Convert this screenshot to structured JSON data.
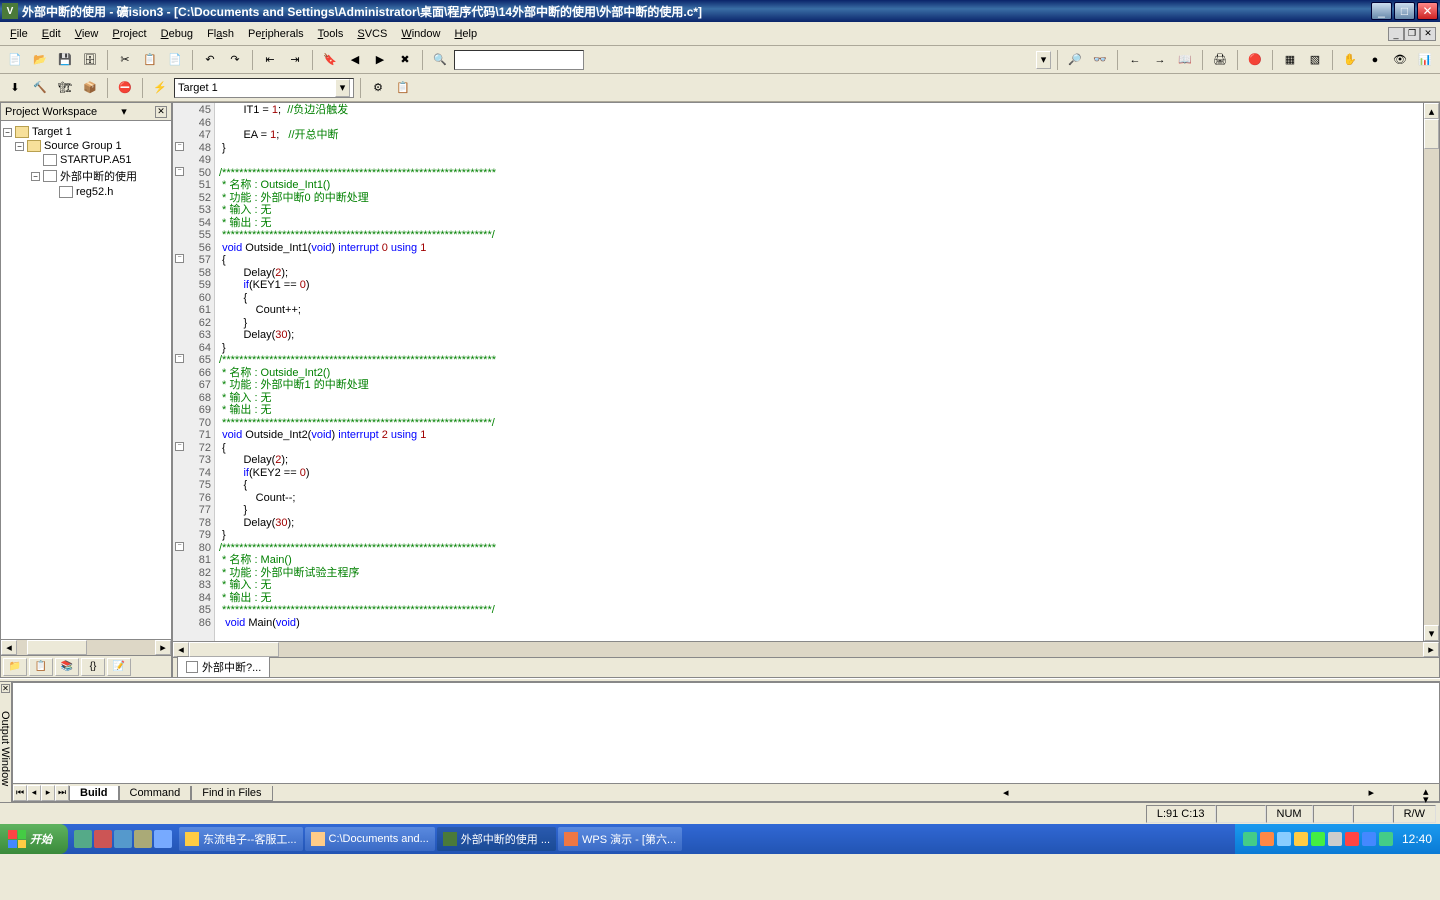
{
  "window": {
    "title": "外部中断的使用  - 礦ision3  - [C:\\Documents and Settings\\Administrator\\桌面\\程序代码\\14外部中断的使用\\外部中断的使用.c*]",
    "app_icon_text": "V"
  },
  "menubar": {
    "file": "File",
    "edit": "Edit",
    "view": "View",
    "project": "Project",
    "debug": "Debug",
    "flash": "Flash",
    "peripherals": "Peripherals",
    "tools": "Tools",
    "svcs": "SVCS",
    "window": "Window",
    "help": "Help"
  },
  "toolbar2": {
    "target_label": "Target 1"
  },
  "workspace": {
    "title": "Project Workspace",
    "root": "Target 1",
    "group": "Source Group 1",
    "file1": "STARTUP.A51",
    "file2": "外部中断的使用",
    "file3": "reg52.h"
  },
  "code": {
    "lines": [
      {
        "n": 45,
        "t": "        IT1 = 1;  ",
        "c": "//负边沿触发"
      },
      {
        "n": 46,
        "t": ""
      },
      {
        "n": 47,
        "t": "        EA = 1;   ",
        "c": "//开总中断"
      },
      {
        "n": 48,
        "t": " }",
        "fold": "open"
      },
      {
        "n": 49,
        "t": ""
      },
      {
        "n": 50,
        "t": "",
        "c": "/****************************************************************",
        "fold": "open"
      },
      {
        "n": 51,
        "t": "",
        "c": " * 名称 : Outside_Int1()"
      },
      {
        "n": 52,
        "t": "",
        "c": " * 功能 : 外部中断0 的中断处理"
      },
      {
        "n": 53,
        "t": "",
        "c": " * 输入 : 无"
      },
      {
        "n": 54,
        "t": "",
        "c": " * 输出 : 无"
      },
      {
        "n": 55,
        "t": "",
        "c": " ***************************************************************/"
      },
      {
        "n": 56,
        "t": " void Outside_Int1(void) interrupt 0 using 1"
      },
      {
        "n": 57,
        "t": " {",
        "fold": "open"
      },
      {
        "n": 58,
        "t": "        Delay(2);"
      },
      {
        "n": 59,
        "t": "        if(KEY1 == 0)"
      },
      {
        "n": 60,
        "t": "        {"
      },
      {
        "n": 61,
        "t": "            Count++;"
      },
      {
        "n": 62,
        "t": "        }"
      },
      {
        "n": 63,
        "t": "        Delay(30);"
      },
      {
        "n": 64,
        "t": " }"
      },
      {
        "n": 65,
        "t": "",
        "c": "/****************************************************************",
        "fold": "open"
      },
      {
        "n": 66,
        "t": "",
        "c": " * 名称 : Outside_Int2()"
      },
      {
        "n": 67,
        "t": "",
        "c": " * 功能 : 外部中断1 的中断处理"
      },
      {
        "n": 68,
        "t": "",
        "c": " * 输入 : 无"
      },
      {
        "n": 69,
        "t": "",
        "c": " * 输出 : 无"
      },
      {
        "n": 70,
        "t": "",
        "c": " ***************************************************************/"
      },
      {
        "n": 71,
        "t": " void Outside_Int2(void) interrupt 2 using 1"
      },
      {
        "n": 72,
        "t": " {",
        "fold": "open"
      },
      {
        "n": 73,
        "t": "        Delay(2);"
      },
      {
        "n": 74,
        "t": "        if(KEY2 == 0)"
      },
      {
        "n": 75,
        "t": "        {"
      },
      {
        "n": 76,
        "t": "            Count--;"
      },
      {
        "n": 77,
        "t": "        }"
      },
      {
        "n": 78,
        "t": "        Delay(30);"
      },
      {
        "n": 79,
        "t": " }"
      },
      {
        "n": 80,
        "t": "",
        "c": "/****************************************************************",
        "fold": "open"
      },
      {
        "n": 81,
        "t": "",
        "c": " * 名称 : Main()"
      },
      {
        "n": 82,
        "t": "",
        "c": " * 功能 : 外部中断试验主程序"
      },
      {
        "n": 83,
        "t": "",
        "c": " * 输入 : 无"
      },
      {
        "n": 84,
        "t": "",
        "c": " * 输出 : 无"
      },
      {
        "n": 85,
        "t": "",
        "c": " ***************************************************************/"
      },
      {
        "n": 86,
        "t": "  void Main(void)"
      }
    ]
  },
  "editor_tab": "外部中断?...",
  "output": {
    "label": "Output Window",
    "tabs": {
      "build": "Build",
      "command": "Command",
      "find": "Find in Files"
    }
  },
  "status": {
    "cursor": "L:91 C:13",
    "num": "NUM",
    "rw": "R/W"
  },
  "taskbar": {
    "start": "开始",
    "task1": "东流电子--客服工...",
    "task2": "C:\\Documents and...",
    "task3": "外部中断的使用 ...",
    "task4": "WPS 演示 - [第六...",
    "clock": "12:40"
  }
}
